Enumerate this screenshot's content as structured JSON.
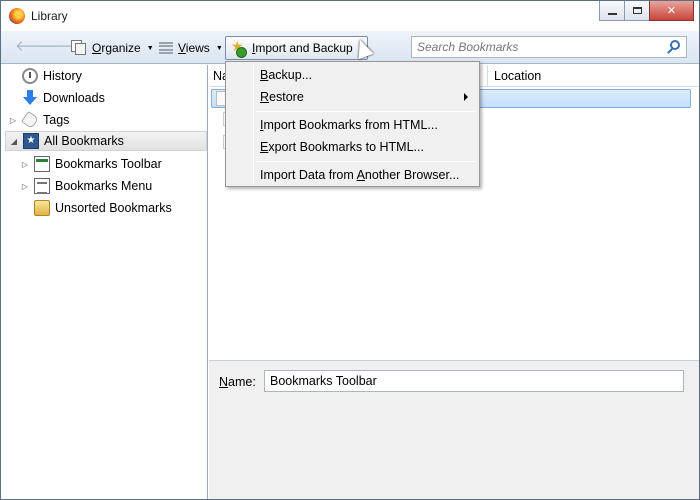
{
  "window": {
    "title": "Library"
  },
  "toolbar": {
    "organize_label": "Organize",
    "organize_underline": "O",
    "views_label": "Views",
    "views_underline": "V",
    "import_backup_label": "Import and Backup",
    "import_backup_underline": "I",
    "back_icon": "back-arrow-icon",
    "forward_icon": "forward-arrow-icon"
  },
  "search": {
    "placeholder": "Search Bookmarks"
  },
  "sidebar": {
    "items": [
      {
        "label": "History",
        "icon": "history-icon"
      },
      {
        "label": "Downloads",
        "icon": "downloads-icon"
      },
      {
        "label": "Tags",
        "icon": "tags-icon"
      },
      {
        "label": "All Bookmarks",
        "icon": "all-bookmarks-icon"
      },
      {
        "label": "Bookmarks Toolbar",
        "icon": "bookmarks-toolbar-icon"
      },
      {
        "label": "Bookmarks Menu",
        "icon": "bookmarks-menu-icon"
      },
      {
        "label": "Unsorted Bookmarks",
        "icon": "unsorted-bookmarks-icon"
      }
    ]
  },
  "list": {
    "columns": [
      "Na",
      "Location"
    ]
  },
  "details": {
    "name_label": "Name:",
    "name_value": "Bookmarks Toolbar"
  },
  "import_menu": {
    "items": [
      {
        "label": "Backup...",
        "accel": "B"
      },
      {
        "label": "Restore",
        "accel": "R",
        "submenu": true
      },
      {
        "label": "Import Bookmarks from HTML...",
        "accel": "I"
      },
      {
        "label": "Export Bookmarks to HTML...",
        "accel": "E"
      },
      {
        "label": "Import Data from Another Browser...",
        "accel": "A"
      }
    ]
  },
  "colors": {
    "selection": "#c4e0fc",
    "selection_border": "#84acdd",
    "toolbar_bg": "#dbe5f1"
  }
}
